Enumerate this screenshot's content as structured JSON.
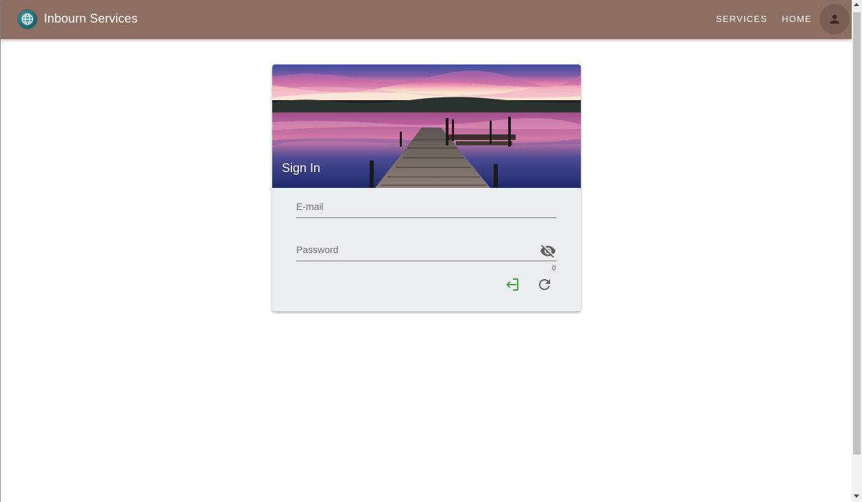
{
  "appbar": {
    "title": "Inbourn Services",
    "logo_icon": "globe-icon",
    "nav": [
      {
        "label": "SERVICES"
      },
      {
        "label": "HOME"
      }
    ],
    "account_icon": "person-icon",
    "color": "#8d6e63"
  },
  "signin": {
    "title": "Sign In",
    "hero_image": "lake-pier-sunset",
    "email": {
      "label": "E-mail",
      "value": ""
    },
    "password": {
      "label": "Password",
      "value": "",
      "toggle_icon": "visibility-off-icon",
      "counter": "0"
    },
    "actions": {
      "login_icon": "login-icon",
      "login_color": "#43a047",
      "refresh_icon": "refresh-icon"
    }
  }
}
